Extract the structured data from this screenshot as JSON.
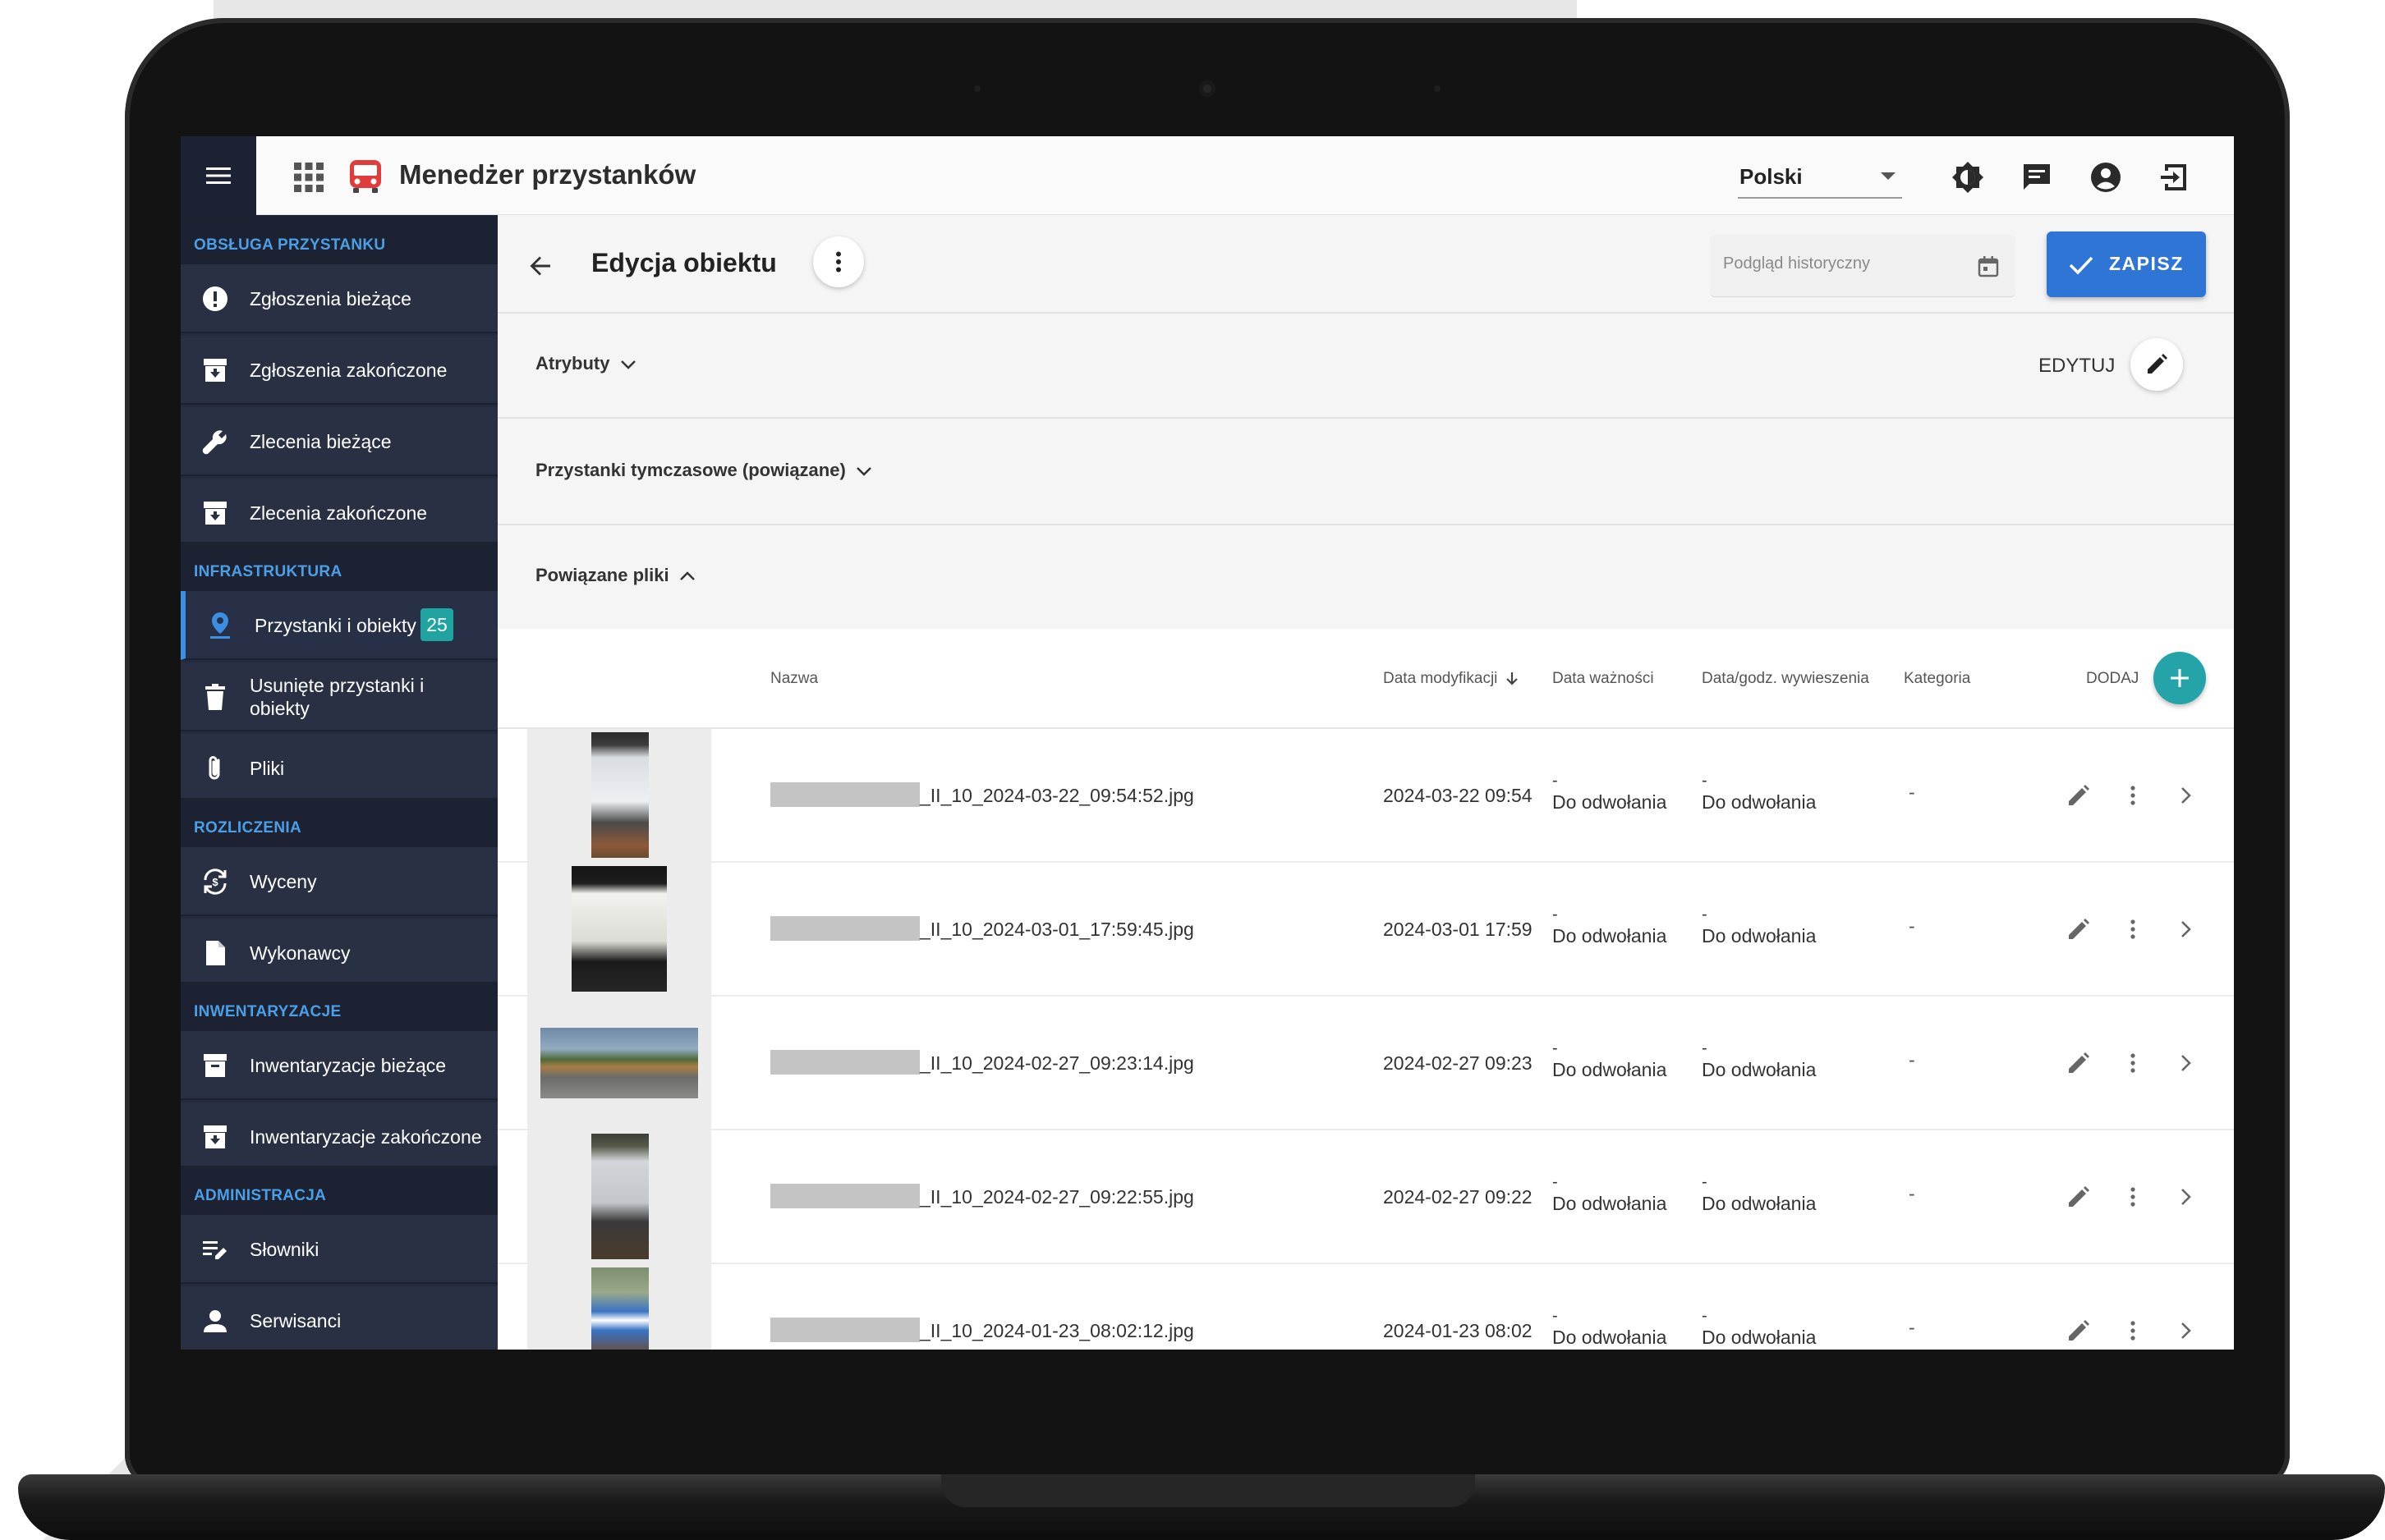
{
  "app": {
    "title": "Menedżer przystanków",
    "language": "Polski"
  },
  "sidebar": {
    "sections": [
      {
        "title": "OBSŁUGA PRZYSTANKU",
        "items": [
          {
            "label": "Zgłoszenia bieżące",
            "icon": "alert-circle-icon"
          },
          {
            "label": "Zgłoszenia zakończone",
            "icon": "archive-in-icon"
          },
          {
            "label": "Zlecenia bieżące",
            "icon": "wrench-icon"
          },
          {
            "label": "Zlecenia zakończone",
            "icon": "archive-in-icon"
          }
        ]
      },
      {
        "title": "INFRASTRUKTURA",
        "items": [
          {
            "label": "Przystanki i obiekty",
            "icon": "map-pin-icon",
            "badge": "25",
            "active": true
          },
          {
            "label": "Usunięte przystanki i obiekty",
            "icon": "trash-icon"
          },
          {
            "label": "Pliki",
            "icon": "paperclip-icon"
          }
        ]
      },
      {
        "title": "ROZLICZENIA",
        "items": [
          {
            "label": "Wyceny",
            "icon": "currency-exchange-icon"
          },
          {
            "label": "Wykonawcy",
            "icon": "document-icon"
          }
        ]
      },
      {
        "title": "INWENTARYZACJE",
        "items": [
          {
            "label": "Inwentaryzacje bieżące",
            "icon": "archive-icon"
          },
          {
            "label": "Inwentaryzacje zakończone",
            "icon": "archive-in-icon"
          }
        ]
      },
      {
        "title": "ADMINISTRACJA",
        "items": [
          {
            "label": "Słowniki",
            "icon": "edit-list-icon"
          },
          {
            "label": "Serwisanci",
            "icon": "person-icon"
          }
        ]
      }
    ]
  },
  "page": {
    "title": "Edycja obiektu",
    "history_placeholder": "Podgląd historyczny",
    "save_label": "ZAPISZ",
    "panels": {
      "attributes": "Atrybuty",
      "temp_stops": "Przystanki tymczasowe (powiązane)",
      "files": "Powiązane pliki"
    },
    "edit_label": "EDYTUJ"
  },
  "files_table": {
    "columns": {
      "name": "Nazwa",
      "modified": "Data modyfikacji",
      "valid": "Data ważności",
      "posted": "Data/godz. wywieszenia",
      "category": "Kategoria"
    },
    "add_label": "DODAJ",
    "rows": [
      {
        "name": "_II_10_2024-03-22_09:54:52.jpg",
        "modified": "2024-03-22 09:54",
        "valid_dash": "-",
        "valid": "Do odwołania",
        "posted_dash": "-",
        "posted": "Do odwołania",
        "category": "-"
      },
      {
        "name": "_II_10_2024-03-01_17:59:45.jpg",
        "modified": "2024-03-01 17:59",
        "valid_dash": "-",
        "valid": "Do odwołania",
        "posted_dash": "-",
        "posted": "Do odwołania",
        "category": "-"
      },
      {
        "name": "_II_10_2024-02-27_09:23:14.jpg",
        "modified": "2024-02-27 09:23",
        "valid_dash": "-",
        "valid": "Do odwołania",
        "posted_dash": "-",
        "posted": "Do odwołania",
        "category": "-"
      },
      {
        "name": "_II_10_2024-02-27_09:22:55.jpg",
        "modified": "2024-02-27 09:22",
        "valid_dash": "-",
        "valid": "Do odwołania",
        "posted_dash": "-",
        "posted": "Do odwołania",
        "category": "-"
      },
      {
        "name": "_II_10_2024-01-23_08:02:12.jpg",
        "modified": "2024-01-23 08:02",
        "valid_dash": "-",
        "valid": "Do odwołania",
        "posted_dash": "-",
        "posted": "Do odwołania",
        "category": "-"
      }
    ]
  },
  "colors": {
    "sidebar": "#252b3d",
    "accent": "#2f75d6",
    "teal": "#24a3a8",
    "section_title": "#4a9fe6"
  }
}
